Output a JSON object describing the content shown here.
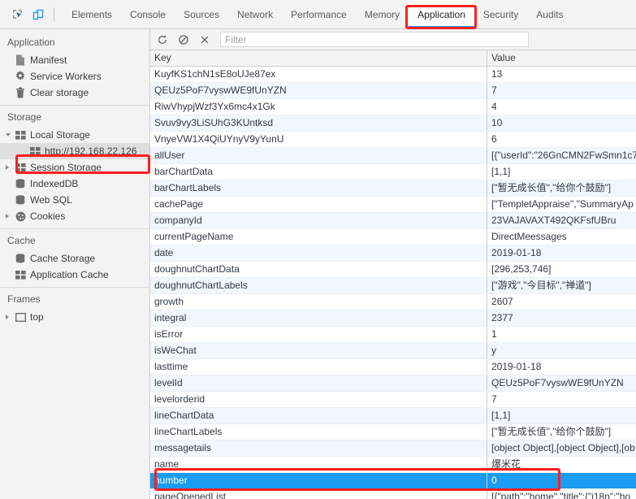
{
  "toolbar": {
    "inspect_icon": "inspect-cursor-icon",
    "device_icon": "device-toolbar-icon"
  },
  "tabs": [
    {
      "label": "Elements",
      "active": false
    },
    {
      "label": "Console",
      "active": false
    },
    {
      "label": "Sources",
      "active": false
    },
    {
      "label": "Network",
      "active": false
    },
    {
      "label": "Performance",
      "active": false
    },
    {
      "label": "Memory",
      "active": false
    },
    {
      "label": "Application",
      "active": true
    },
    {
      "label": "Security",
      "active": false
    },
    {
      "label": "Audits",
      "active": false
    }
  ],
  "sidebar": {
    "sections": [
      {
        "title": "Application",
        "items": [
          {
            "label": "Manifest",
            "icon": "manifest-file-icon",
            "indent": 1,
            "arrow": "none",
            "selected": false
          },
          {
            "label": "Service Workers",
            "icon": "gear-icon",
            "indent": 1,
            "arrow": "none",
            "selected": false
          },
          {
            "label": "Clear storage",
            "icon": "trash-icon",
            "indent": 1,
            "arrow": "none",
            "selected": false
          }
        ]
      },
      {
        "title": "Storage",
        "items": [
          {
            "label": "Local Storage",
            "icon": "storage-grid-icon",
            "indent": 1,
            "arrow": "open",
            "selected": false
          },
          {
            "label": "http://192.168.22.126",
            "icon": "storage-grid-icon",
            "indent": 2,
            "arrow": "none",
            "selected": true
          },
          {
            "label": "Session Storage",
            "icon": "storage-grid-icon",
            "indent": 1,
            "arrow": "closed",
            "selected": false
          },
          {
            "label": "IndexedDB",
            "icon": "database-icon",
            "indent": 1,
            "arrow": "none",
            "selected": false
          },
          {
            "label": "Web SQL",
            "icon": "database-icon",
            "indent": 1,
            "arrow": "none",
            "selected": false
          },
          {
            "label": "Cookies",
            "icon": "cookie-icon",
            "indent": 1,
            "arrow": "closed",
            "selected": false
          }
        ]
      },
      {
        "title": "Cache",
        "items": [
          {
            "label": "Cache Storage",
            "icon": "database-icon",
            "indent": 1,
            "arrow": "none",
            "selected": false
          },
          {
            "label": "Application Cache",
            "icon": "storage-grid-icon",
            "indent": 1,
            "arrow": "none",
            "selected": false
          }
        ]
      },
      {
        "title": "Frames",
        "items": [
          {
            "label": "top",
            "icon": "frame-icon",
            "indent": 1,
            "arrow": "closed",
            "selected": false
          }
        ]
      }
    ]
  },
  "pane_toolbar": {
    "refresh_icon": "refresh-icon",
    "clear_icon": "clear-all-icon",
    "delete_icon": "delete-selected-icon",
    "filter_placeholder": "Filter",
    "filter_value": ""
  },
  "table": {
    "columns": [
      "Key",
      "Value"
    ],
    "rows": [
      {
        "key": "KuyfKS1chN1sE8oUJe87ex",
        "value": "13",
        "selected": false
      },
      {
        "key": "QEUz5PoF7vyswWE9fUnYZN",
        "value": "7",
        "selected": false
      },
      {
        "key": "RiwVhypjWzf3Yx6mc4x1Gk",
        "value": "4",
        "selected": false
      },
      {
        "key": "Svuv9vy3LiSUhG3KUntksd",
        "value": "10",
        "selected": false
      },
      {
        "key": "VnyeVW1X4QiUYnyV9yYunU",
        "value": "6",
        "selected": false
      },
      {
        "key": "allUser",
        "value": "[{\"userId\":\"26GnCMN2FwSmn1c7",
        "selected": false
      },
      {
        "key": "barChartData",
        "value": "[1,1]",
        "selected": false
      },
      {
        "key": "barChartLabels",
        "value": "[\"暂无成长值\",\"给你个鼓励\"]",
        "selected": false
      },
      {
        "key": "cachePage",
        "value": "[\"TempletAppraise\",\"SummaryAp",
        "selected": false
      },
      {
        "key": "companyId",
        "value": "23VAJAVAXT492QKFsfUBru",
        "selected": false
      },
      {
        "key": "currentPageName",
        "value": "DirectMeessages",
        "selected": false
      },
      {
        "key": "date",
        "value": "2019-01-18",
        "selected": false
      },
      {
        "key": "doughnutChartData",
        "value": "[296,253,746]",
        "selected": false
      },
      {
        "key": "doughnutChartLabels",
        "value": "[\"游戏\",\"今目标\",\"禅道\"]",
        "selected": false
      },
      {
        "key": "growth",
        "value": "2607",
        "selected": false
      },
      {
        "key": "integral",
        "value": "2377",
        "selected": false
      },
      {
        "key": "isError",
        "value": "1",
        "selected": false
      },
      {
        "key": "isWeChat",
        "value": "y",
        "selected": false
      },
      {
        "key": "lasttime",
        "value": "2019-01-18",
        "selected": false
      },
      {
        "key": "levelId",
        "value": "QEUz5PoF7vyswWE9fUnYZN",
        "selected": false
      },
      {
        "key": "levelorderid",
        "value": "7",
        "selected": false
      },
      {
        "key": "lineChartData",
        "value": "[1,1]",
        "selected": false
      },
      {
        "key": "lineChartLabels",
        "value": "[\"暂无成长值\",\"给你个鼓励\"]",
        "selected": false
      },
      {
        "key": "messagetails",
        "value": "[object Object],[object Object],[ob",
        "selected": false
      },
      {
        "key": "name",
        "value": "爆米花",
        "selected": false
      },
      {
        "key": "number",
        "value": "0",
        "selected": true
      },
      {
        "key": "pageOpenedList",
        "value": "[{\"path\":\"home\",\"title\":{\"i18n\":\"ho",
        "selected": false
      }
    ]
  },
  "annotations": {
    "color": "#ff1f1f",
    "boxes": [
      "application-tab",
      "local-storage-origin",
      "number-row"
    ]
  }
}
